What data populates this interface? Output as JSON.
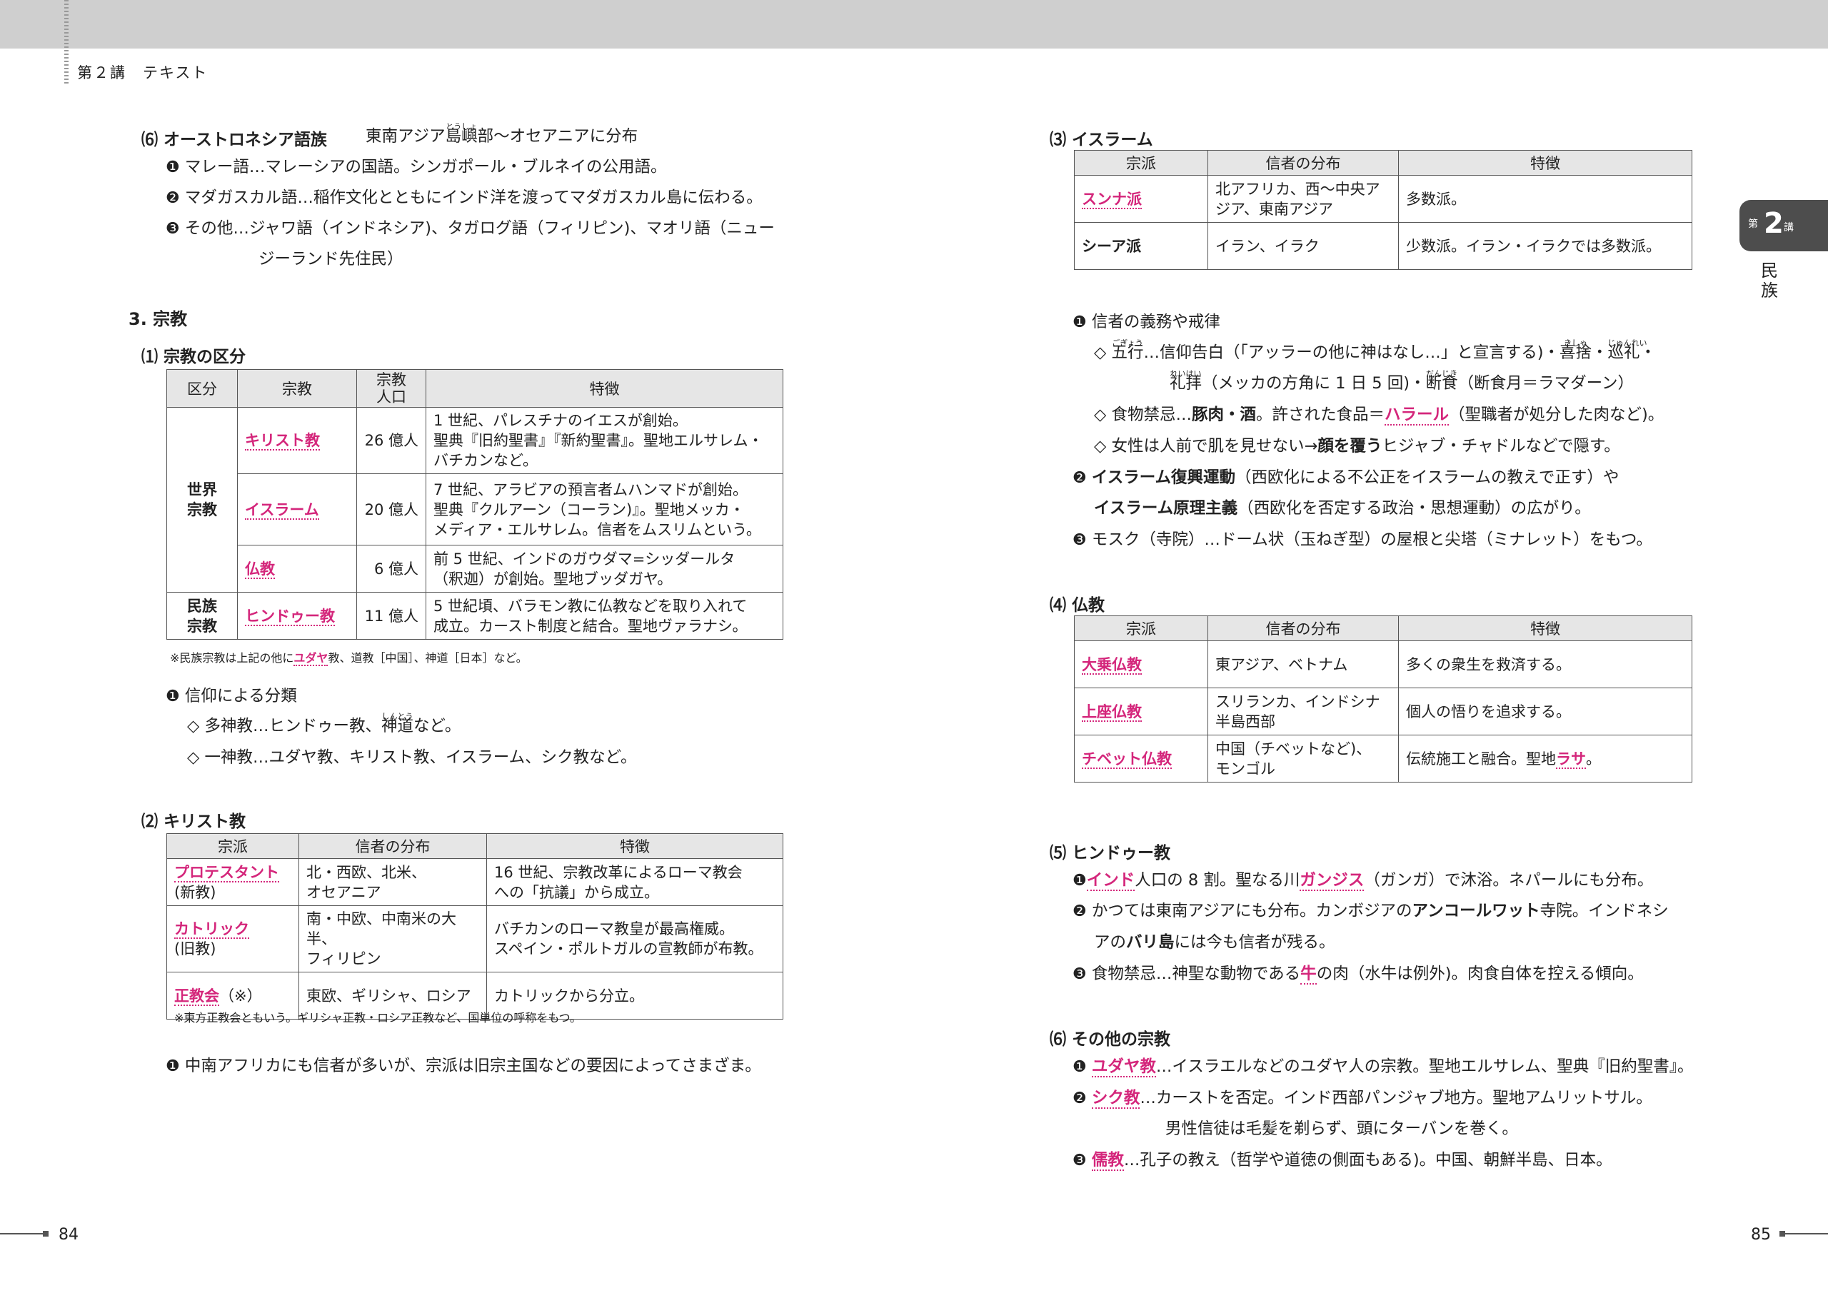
{
  "header": {
    "title": "第２講　テキスト"
  },
  "page_left": "84",
  "page_right": "85",
  "tab": {
    "pre": "第",
    "num": "2",
    "suf": "講",
    "side": "民族"
  },
  "left": {
    "s6_head": "⑹ オーストロネシア語族",
    "s6_sub_a": "東南アジア",
    "s6_sub_ruby": "島嶼",
    "s6_sub_ruby_rt": "とうしょ",
    "s6_sub_b": "部～オセアニアに分布",
    "s6_1": "マレー語…マレーシアの国語。シンガポール・ブルネイの公用語。",
    "s6_2": "マダガスカル語…稲作文化とともにインド洋を渡ってマダガスカル島に伝わる。",
    "s6_3a": "その他…ジャワ語（インドネシア)、タガログ語（フィリピン)、マオリ語（ニュー",
    "s6_3b": "ジーランド先住民）",
    "h3": "3. 宗教",
    "s1_head": "⑴ 宗教の区分",
    "t1": {
      "head": [
        "区分",
        "宗教",
        "宗教",
        "人口",
        "特徴"
      ],
      "group1": "世界",
      "group1b": "宗教",
      "group2": "民族",
      "group2b": "宗教",
      "rows": [
        {
          "name": "キリスト教",
          "pop": "26 億人",
          "f1": "1 世紀、パレスチナのイエスが創始。",
          "f2": "聖典『旧約聖書』『新約聖書』。聖地エルサレム・",
          "f3": "バチカンなど。"
        },
        {
          "name": "イスラーム",
          "pop": "20 億人",
          "f1": "7 世紀、アラビアの預言者ムハンマドが創始。",
          "f2": "聖典『クルアーン（コーラン)』。聖地メッカ・",
          "f3": "メディア・エルサレム。信者をムスリムという。"
        },
        {
          "name": "仏教",
          "pop": "6 億人",
          "f1": "前 5 世紀、インドのガウダマ=シッダールタ",
          "f2": "（釈迦）が創始。聖地ブッダガヤ。",
          "f3": ""
        },
        {
          "name": "ヒンドゥー教",
          "pop": "11 億人",
          "f1": "5 世紀頃、バラモン教に仏教などを取り入れて",
          "f2": "成立。カースト制度と結合。聖地ヴァラナシ。",
          "f3": ""
        }
      ],
      "note_a": "※民族宗教は上記の他に",
      "note_pink": "ユダヤ",
      "note_b": "教、道教［中国］、神道［日本］など。"
    },
    "b1_head": "信仰による分類",
    "b1_1a": "◇ 多神教…ヒンドゥー教、",
    "b1_1ruby": "神道",
    "b1_1rt": "しんとう",
    "b1_1b": "など。",
    "b1_2": "◇ 一神教…ユダヤ教、キリスト教、イスラーム、シク教など。",
    "s2_head": "⑵ キリスト教",
    "t2": {
      "head": [
        "宗派",
        "信者の分布",
        "特徴"
      ],
      "rows": [
        {
          "name": "プロテスタント",
          "sub": "(新教)",
          "d1": "北・西欧、北米、",
          "d2": "オセアニア",
          "f1": "16 世紀、宗教改革によるローマ教会",
          "f2": "への「抗議」から成立。"
        },
        {
          "name": "カトリック",
          "sub": "(旧教)",
          "d1": "南・中欧、中南米の大半、",
          "d2": "フィリピン",
          "f1": "バチカンのローマ教皇が最高権威。",
          "f2": "スペイン・ポルトガルの宣教師が布教。"
        },
        {
          "name": "正教会",
          "sub": "（※）",
          "d1": "東欧、ギリシャ、ロシア",
          "d2": "",
          "f1": "カトリックから分立。",
          "f2": ""
        }
      ],
      "note": "※東方正教会ともいう。ギリシャ正教・ロシア正教など、国単位の呼称をもつ。"
    },
    "c1": "中南アフリカにも信者が多いが、宗派は旧宗主国などの要因によってさまざま。"
  },
  "right": {
    "s3_head": "⑶ イスラーム",
    "t3": {
      "head": [
        "宗派",
        "信者の分布",
        "特徴"
      ],
      "rows": [
        {
          "name": "スンナ派",
          "d1": "北アフリカ、西～中央ア",
          "d2": "ジア、東南アジア",
          "f": "多数派。"
        },
        {
          "name": "シーア派",
          "d1": "イラン、イラク",
          "d2": "",
          "f": "少数派。イラン・イラクでは多数派。"
        }
      ]
    },
    "i1_head": "信者の義務や戒律",
    "i1_1a": "◇ ",
    "i1_1r1": "五行",
    "i1_1r1t": "ごぎょう",
    "i1_1b": "…信仰告白（「アッラーの他に神はなし…」と宣言する)・",
    "i1_1r2": "喜捨",
    "i1_1r2t": "きしゃ",
    "i1_1c": "・",
    "i1_1r3": "巡礼",
    "i1_1r3t": "じゅんれい",
    "i1_1d": "・",
    "i1_2r1": "礼拝",
    "i1_2r1t": "れいはい",
    "i1_2a": "（メッカの方角に 1 日 5 回)・",
    "i1_2r2": "断食",
    "i1_2r2t": "だんじき",
    "i1_2b": "（断食月＝ラマダーン）",
    "i1_3a": "◇ 食物禁忌…",
    "i1_3b": "豚肉・酒",
    "i1_3c": "。許された食品＝",
    "i1_3p": "ハラール",
    "i1_3d": "（聖職者が処分した肉など)。",
    "i1_4a": "◇ 女性は人前で肌を見せない→",
    "i1_4b": "顔を覆う",
    "i1_4c": "ヒジャブ・チャドルなどで隠す。",
    "i2_b1": "イスラーム復興運動",
    "i2_a": "（西欧化による不公正をイスラームの教えで正す）や",
    "i2_b2": "イスラーム原理主義",
    "i2_c": "（西欧化を否定する政治・思想運動）の広がり。",
    "i3": "モスク（寺院）…ドーム状（玉ねぎ型）の屋根と尖塔（ミナレット）をもつ。",
    "s4_head": "⑷ 仏教",
    "t4": {
      "head": [
        "宗派",
        "信者の分布",
        "特徴"
      ],
      "rows": [
        {
          "name": "大乗仏教",
          "d1": "東アジア、ベトナム",
          "d2": "",
          "f": "多くの衆生を救済する。",
          "fp": "",
          "fe": ""
        },
        {
          "name": "上座仏教",
          "d1": "スリランカ、インドシナ",
          "d2": "半島西部",
          "f": "個人の悟りを追求する。",
          "fp": "",
          "fe": ""
        },
        {
          "name": "チベット仏教",
          "d1": "中国（チベットなど)、",
          "d2": "モンゴル",
          "f": "伝統施工と融合。聖地",
          "fp": "ラサ",
          "fe": "。"
        }
      ]
    },
    "s5_head": "⑸ ヒンドゥー教",
    "h1_p1": "インド",
    "h1_a": "人口の 8 割。聖なる川",
    "h1_p2": "ガンジス",
    "h1_b": "（ガンガ）で沐浴。ネパールにも分布。",
    "h2_a": "かつては東南アジアにも分布。カンボジアの",
    "h2_b": "アンコールワット",
    "h2_c": "寺院。インドネシ",
    "h2_d": "アの",
    "h2_e": "バリ島",
    "h2_f": "には今も信者が残る。",
    "h3_a": "食物禁忌…神聖な動物である",
    "h3_b": "牛",
    "h3_c": "の肉（水牛は例外)。肉食自体を控える傾向。",
    "s6_head": "⑹ その他の宗教",
    "o1_p": "ユダヤ教",
    "o1": "…イスラエルなどのユダヤ人の宗教。聖地エルサレム、聖典『旧約聖書』。",
    "o2_p": "シク教",
    "o2": "…カーストを否定。インド西部パンジャブ地方。聖地アムリットサル。",
    "o2b": "男性信徒は毛髪を剃らず、頭にターバンを巻く。",
    "o3_p": "儒教",
    "o3": "…孔子の教え（哲学や道徳の側面もある)。中国、朝鮮半島、日本。"
  }
}
